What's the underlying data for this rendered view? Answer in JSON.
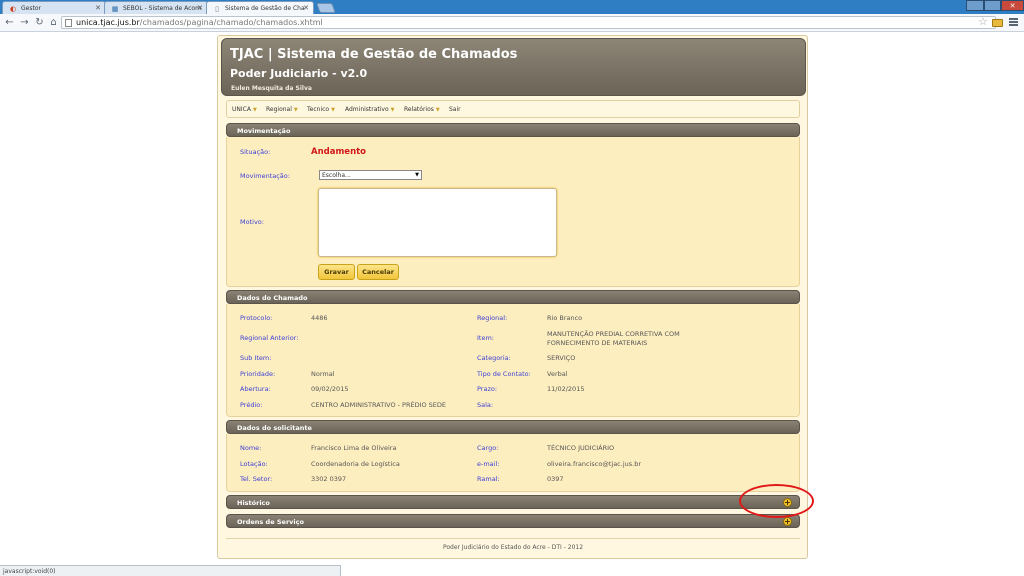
{
  "browser": {
    "tabs": [
      {
        "title": "Gestor",
        "active": false
      },
      {
        "title": "SEBOL - Sistema de Acom",
        "active": false
      },
      {
        "title": "Sistema de Gestão de Cha",
        "active": true
      }
    ],
    "address": {
      "host": "unica.tjac.jus.br",
      "path": "/chamados/pagina/chamado/chamados.xhtml"
    },
    "status_text": "javascript:void(0)"
  },
  "app": {
    "title": "TJAC | Sistema de Gestão de Chamados",
    "subtitle": "Poder Judiciario - v2.0",
    "user": "Eulen Mesquita da Silva",
    "menu": [
      "UNICA",
      "Regional",
      "Tecnico",
      "Administrativo",
      "Relatórios",
      "Sair"
    ],
    "movimentacao": {
      "header": "Movimentação",
      "situacao_label": "Situação:",
      "situacao_value": "Andamento",
      "movimentacao_label": "Movimentação:",
      "movimentacao_selected": "Escolha...",
      "motivo_label": "Motivo:",
      "motivo_value": "",
      "save_label": "Gravar",
      "cancel_label": "Cancelar"
    },
    "dados_chamado": {
      "header": "Dados do Chamado",
      "left": [
        {
          "label": "Protocolo:",
          "value": "4486"
        },
        {
          "label": "Regional Anterior:",
          "value": ""
        },
        {
          "label": "Sub Item:",
          "value": ""
        },
        {
          "label": "Prioridade:",
          "value": "Normal"
        },
        {
          "label": "Abertura:",
          "value": "09/02/2015"
        },
        {
          "label": "Prédio:",
          "value": "CENTRO ADMINISTRATIVO - PRÉDIO SEDE"
        }
      ],
      "right": [
        {
          "label": "Regional:",
          "value": "Rio Branco"
        },
        {
          "label": "Item:",
          "value": "MANUTENÇÃO PREDIAL CORRETIVA COM FORNECIMENTO DE MATERIAIS"
        },
        {
          "label": "Categoria:",
          "value": "SERVIÇO"
        },
        {
          "label": "Tipo de Contato:",
          "value": "Verbal"
        },
        {
          "label": "Prazo:",
          "value": "11/02/2015"
        },
        {
          "label": "Sala:",
          "value": ""
        }
      ]
    },
    "dados_solicitante": {
      "header": "Dados do solicitante",
      "left": [
        {
          "label": "Nome:",
          "value": "Francisco Lima de Oliveira"
        },
        {
          "label": "Lotação:",
          "value": "Coordenadoria de Logística"
        },
        {
          "label": "Tel. Setor:",
          "value": "3302 0397"
        }
      ],
      "right": [
        {
          "label": "Cargo:",
          "value": "TÉCNICO JUDICIÁRIO"
        },
        {
          "label": "e-mail:",
          "value": "oliveira.francisco@tjac.jus.br"
        },
        {
          "label": "Ramal:",
          "value": "0397"
        }
      ]
    },
    "historico": {
      "header": "Histórico"
    },
    "ordens": {
      "header": "Ordens de Serviço"
    },
    "footer": "Poder Judiciário do Estado do Acre - DTI - 2012"
  }
}
